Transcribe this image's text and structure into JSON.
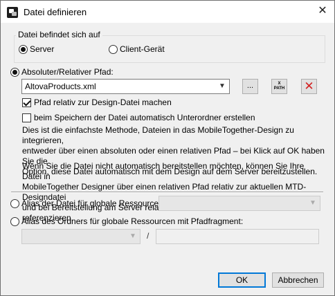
{
  "window": {
    "title": "Datei definieren",
    "close_glyph": "✕"
  },
  "location_group": {
    "title": "Datei befindet sich auf",
    "server_label": "Server",
    "client_label": "Client-Gerät",
    "selected": "Server"
  },
  "path_option": {
    "label": "Absoluter/Relativer Pfad:",
    "value": "AltovaProducts.xml",
    "browse_label": "...",
    "xpath_label_top": "X",
    "xpath_label_bottom": "PATH",
    "delete_glyph": "✕",
    "relative_checkbox": "Pfad relativ zur Design-Datei machen",
    "relative_checked": true,
    "subfolders_checkbox": "beim Speichern der Datei automatisch Unterordner erstellen",
    "subfolders_checked": false,
    "description_1": "Dies ist die einfachste Methode, Dateien in das MobileTogether-Design zu integrieren,\nentweder über einen absoluten oder einen relativen Pfad – bei Klick auf OK haben Sie die\nOption, diese Datei automatisch mit dem Design auf dem Server bereitzustellen.",
    "description_2": "Wenn Sie die Datei nicht automatisch bereitstellen möchten, können Sie Ihre Datei in\nMobileTogether Designer über einen relativen Pfad relativ zur aktuellen MTD-Designdatei\nund bei Bereitstellung am Server relativ zum Server-Arbeitsverzeichnis referenzieren."
  },
  "alias_file": {
    "label": "Alias der Datei für globale Ressourcen:",
    "value": ""
  },
  "alias_folder": {
    "label": "Alias des Ordners für globale Ressourcen mit Pfadfragment:",
    "value": "",
    "separator": "/",
    "fragment": ""
  },
  "buttons": {
    "ok": "OK",
    "cancel": "Abbrechen"
  },
  "colors": {
    "accent": "#0078d7",
    "delete": "#d32020"
  }
}
